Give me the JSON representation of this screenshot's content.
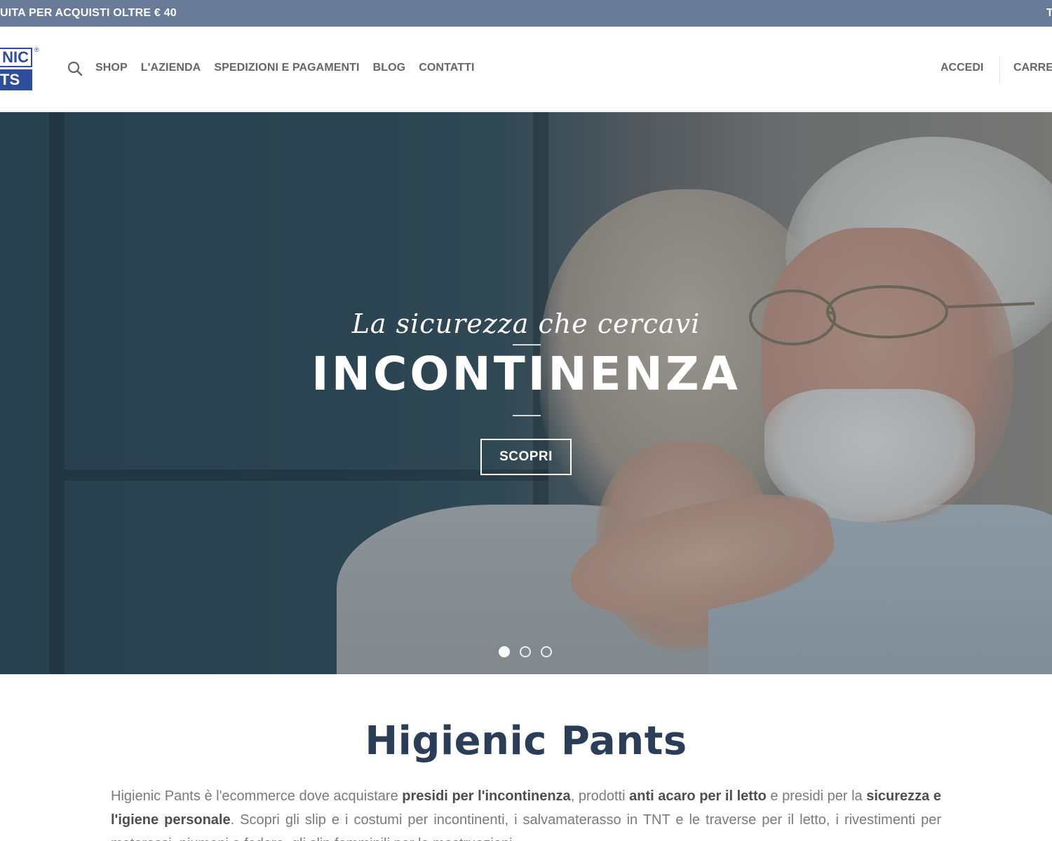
{
  "topbar": {
    "promo": "UITA PER ACQUISTI OLTRE € 40",
    "right_fragment": "T"
  },
  "header": {
    "logo": {
      "line1": "NIC",
      "line2": "TS",
      "reg": "®"
    },
    "search_icon": "search-icon",
    "nav": [
      "SHOP",
      "L'AZIENDA",
      "SPEDIZIONI E PAGAMENTI",
      "BLOG",
      "CONTATTI"
    ],
    "login_label": "ACCEDI",
    "cart_label": "CARRE"
  },
  "hero": {
    "script_text": "La sicurezza che cercavi",
    "headline": "INCONTINENZA",
    "cta_label": "SCOPRI",
    "slides_count": 3,
    "active_slide": 1
  },
  "intro": {
    "title": "Higienic Pants",
    "p1_a": "Higienic Pants è l'ecommerce dove acquistare ",
    "p1_b": "presidi per l'incontinenza",
    "p1_c": ", prodotti ",
    "p1_d": "anti acaro per il letto",
    "p1_e": " e presidi per la ",
    "p1_f": "sicurezza e l'igiene personale",
    "p1_g": ". Scopri gli slip e i costumi per incontinenti, i salvamaterasso in TNT e le traverse per il letto, i rivestimenti per materassi, piumoni e federe, gli slip femminili per le mestruazioni."
  },
  "colors": {
    "topbar_bg": "#697b99",
    "brand_blue": "#2e4d9b",
    "title_navy": "#2c3e57",
    "nav_text": "#666666"
  }
}
